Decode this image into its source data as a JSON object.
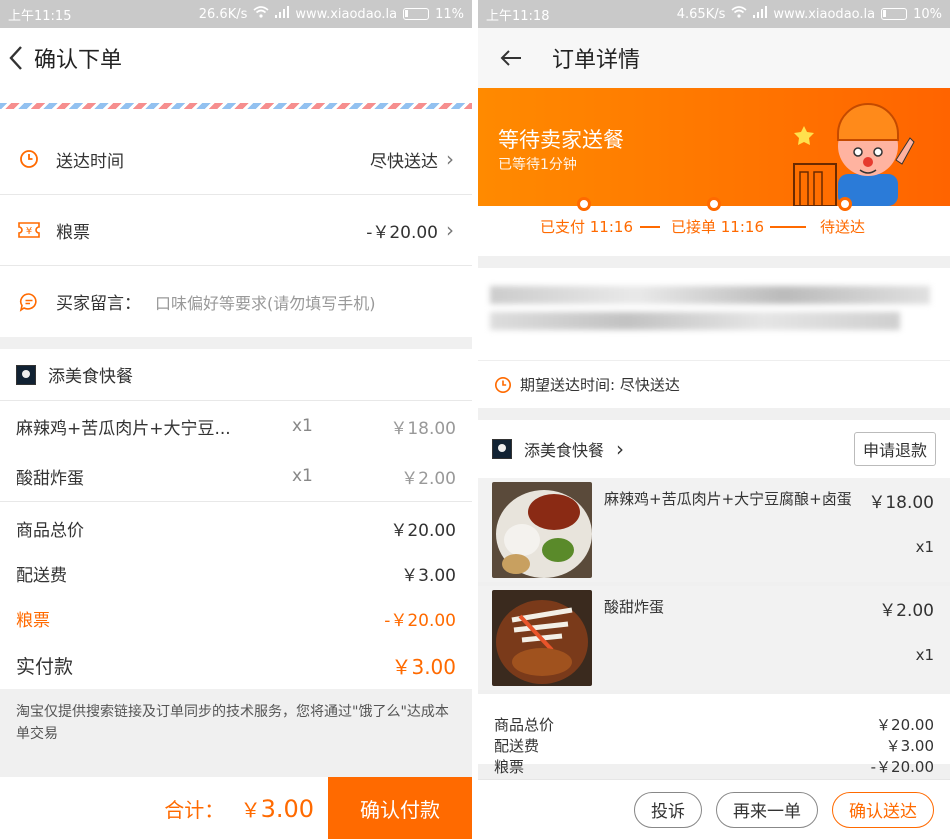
{
  "left": {
    "status": {
      "time": "上午11:15",
      "speed": "26.6K/s",
      "site": "www.xiaodao.la",
      "battery": "11%"
    },
    "title": "确认下单",
    "delivery_time": {
      "label": "送达时间",
      "value": "尽快送达"
    },
    "coupon": {
      "label": "粮票",
      "value": "-￥20.00"
    },
    "message": {
      "label": "买家留言：",
      "placeholder": "口味偏好等要求(请勿填写手机)"
    },
    "shop_name": "添美食快餐",
    "items": [
      {
        "name": "麻辣鸡+苦瓜肉片+大宁豆...",
        "qty": "x1",
        "price": "￥18.00"
      },
      {
        "name": "酸甜炸蛋",
        "qty": "x1",
        "price": "￥2.00"
      }
    ],
    "summary": {
      "goods_label": "商品总价",
      "goods_value": "￥20.00",
      "shipping_label": "配送费",
      "shipping_value": "￥3.00",
      "coupon_label": "粮票",
      "coupon_value": "-￥20.00",
      "paid_label": "实付款",
      "paid_value": "￥3.00"
    },
    "notice": "淘宝仅提供搜索链接及订单同步的技术服务，您将通过\"饿了么\"达成本单交易",
    "footer": {
      "total_label": "合计：",
      "total_currency": "￥",
      "total_value": "3.00",
      "pay_button": "确认付款"
    }
  },
  "right": {
    "status": {
      "time": "上午11:18",
      "speed": "4.65K/s",
      "site": "www.xiaodao.la",
      "battery": "10%"
    },
    "title": "订单详情",
    "banner": {
      "headline": "等待卖家送餐",
      "sub": "已等待1分钟"
    },
    "progress": [
      {
        "label": "已支付 11:16"
      },
      {
        "label": "已接单 11:16"
      },
      {
        "label": "待送达"
      }
    ],
    "expected": "期望送达时间: 尽快送达",
    "shop_name": "添美食快餐",
    "refund_button": "申请退款",
    "items": [
      {
        "name": "麻辣鸡+苦瓜肉片+大宁豆腐酿+卤蛋",
        "price": "￥18.00",
        "qty": "x1"
      },
      {
        "name": "酸甜炸蛋",
        "price": "￥2.00",
        "qty": "x1"
      }
    ],
    "summary": [
      {
        "label": "商品总价",
        "value": "￥20.00"
      },
      {
        "label": "配送费",
        "value": "￥3.00"
      },
      {
        "label": "粮票",
        "value": "-￥20.00"
      }
    ],
    "buttons": {
      "complain": "投诉",
      "reorder": "再来一单",
      "confirm": "确认送达"
    }
  },
  "colors": {
    "accent": "#ff6a00",
    "statusbar": "#c9c9c9"
  }
}
